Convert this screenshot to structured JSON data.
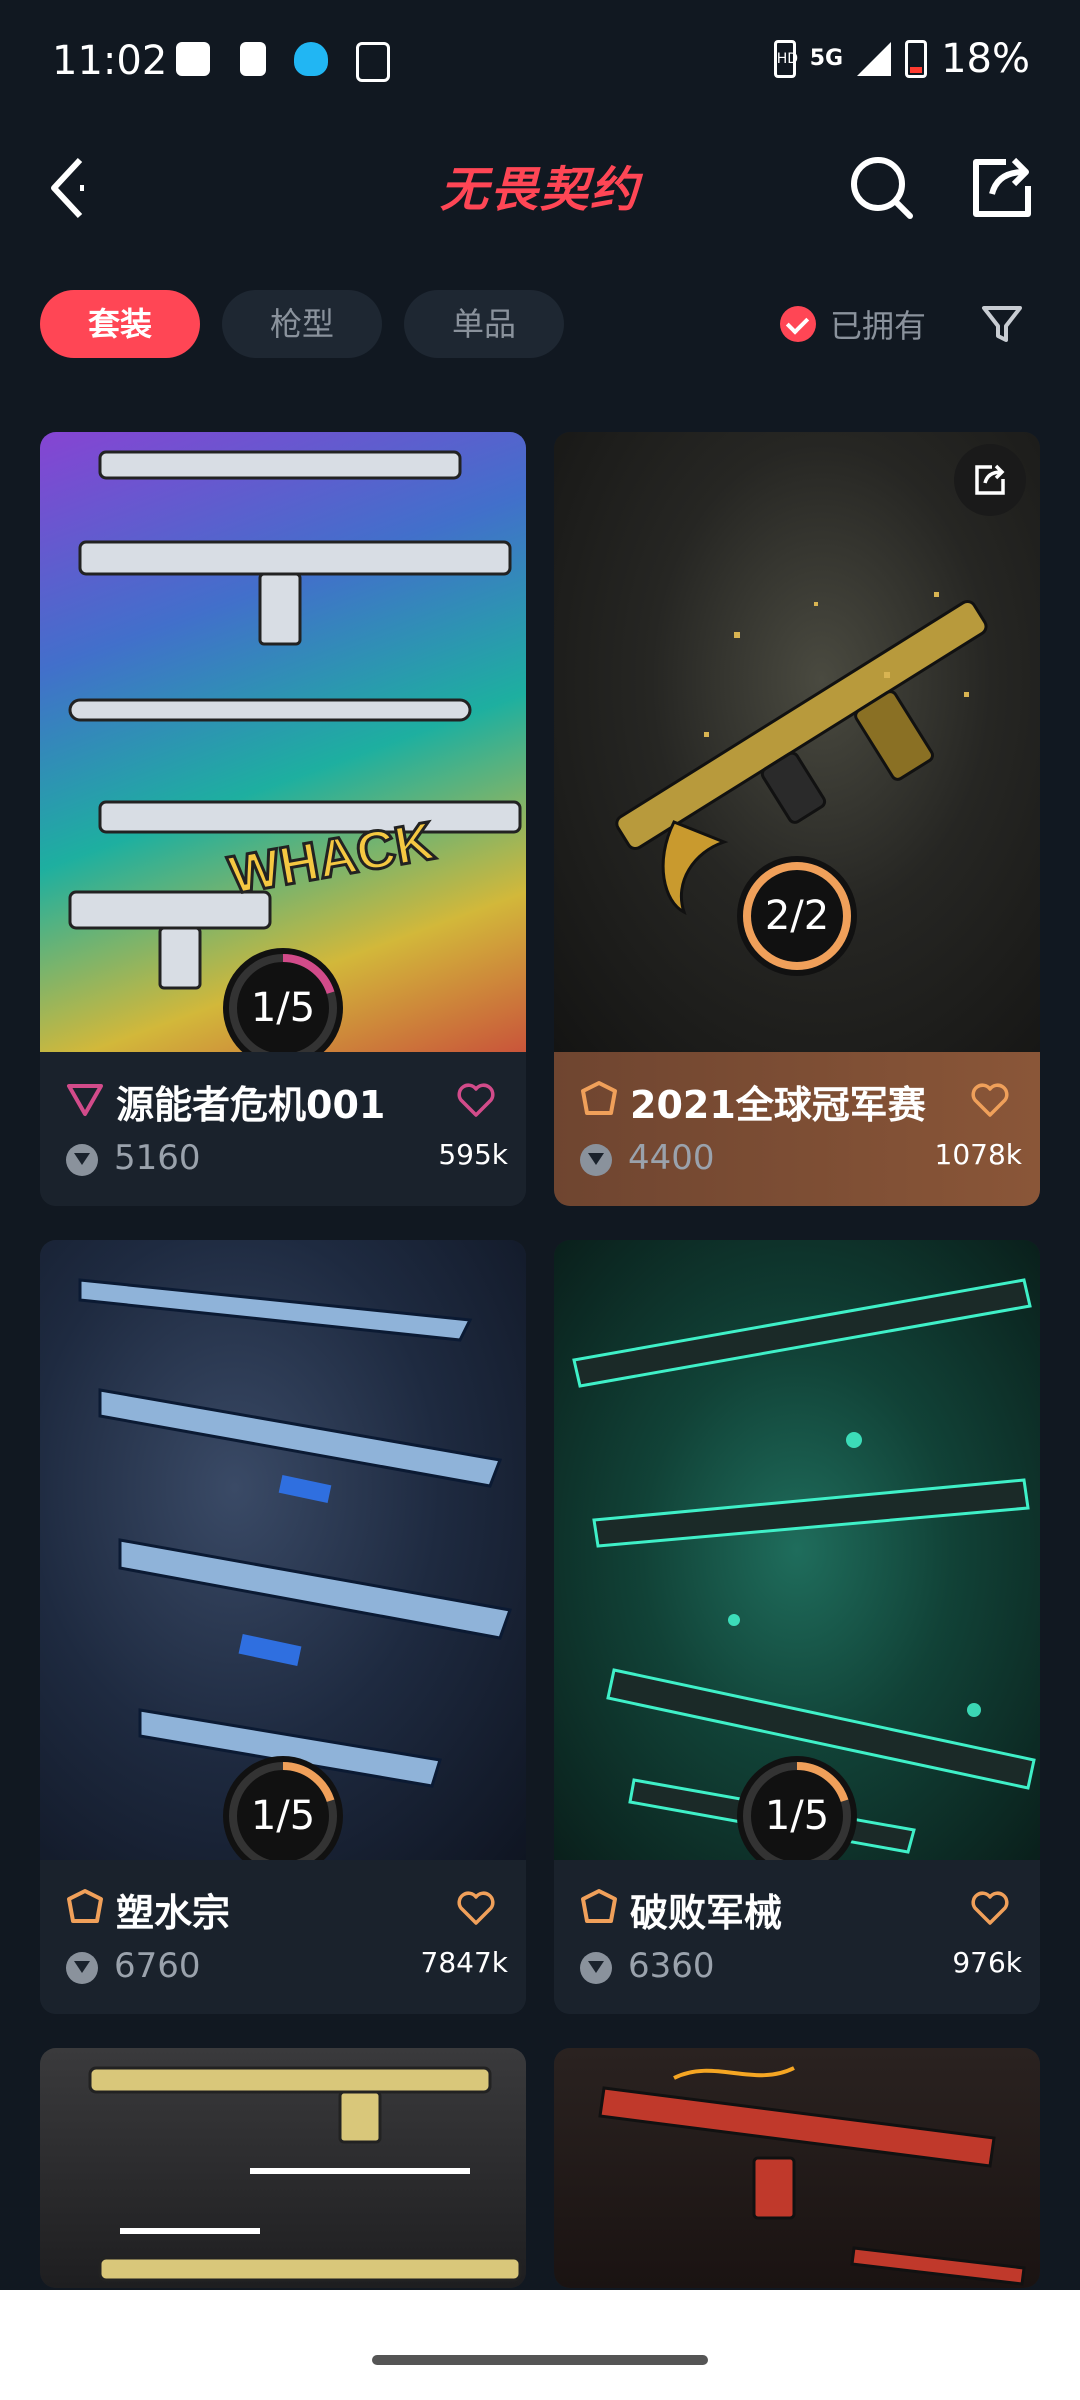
{
  "status_bar": {
    "time": "11:02",
    "network": "5G",
    "battery": "18%"
  },
  "header": {
    "title": "无畏契约"
  },
  "filters": {
    "tabs": [
      {
        "label": "套装"
      },
      {
        "label": "枪型"
      },
      {
        "label": "单品"
      }
    ],
    "owned_label": "已拥有"
  },
  "cards": [
    {
      "name": "源能者危机001",
      "price": "5160",
      "likes": "595k",
      "progress": "1/5",
      "tier_color": "#d24b8a"
    },
    {
      "name": "2021全球冠军赛",
      "price": "4400",
      "likes": "1078k",
      "progress": "2/2",
      "tier_color": "#f0a05a"
    },
    {
      "name": "塑水宗",
      "price": "6760",
      "likes": "7847k",
      "progress": "1/5",
      "tier_color": "#f0a05a"
    },
    {
      "name": "破败军械",
      "price": "6360",
      "likes": "976k",
      "progress": "1/5",
      "tier_color": "#f0a05a"
    }
  ],
  "colors": {
    "accent": "#ff4655",
    "background": "#111821",
    "card": "#1a222c"
  }
}
